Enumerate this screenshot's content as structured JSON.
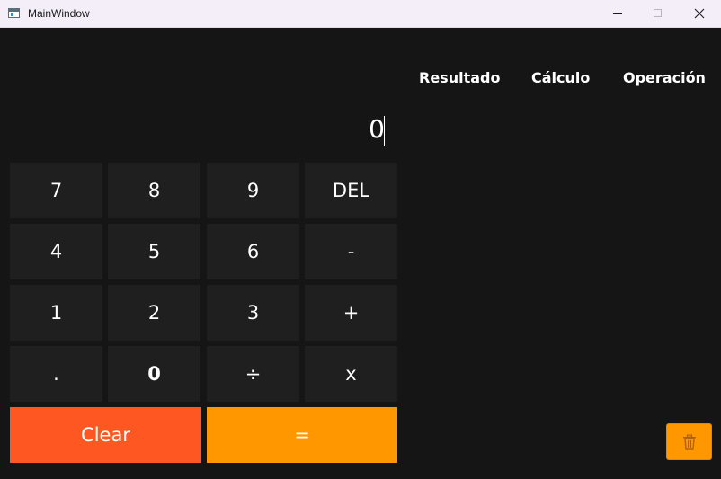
{
  "window": {
    "title": "MainWindow"
  },
  "display": {
    "value": "0"
  },
  "keypad": {
    "rows": [
      [
        "7",
        "8",
        "9",
        "DEL"
      ],
      [
        "4",
        "5",
        "6",
        "-"
      ],
      [
        "1",
        "2",
        "3",
        "+"
      ],
      [
        ".",
        "0",
        "÷",
        "x"
      ]
    ],
    "clear_label": "Clear",
    "equals_label": "="
  },
  "history": {
    "headers": [
      "Resultado",
      "Cálculo",
      "Operación"
    ],
    "delete_icon": "trash-icon"
  },
  "colors": {
    "background": "#151515",
    "key": "#1f1f1f",
    "clear": "#ff5722",
    "equals": "#ff9800",
    "trash_button": "#ff9800"
  }
}
